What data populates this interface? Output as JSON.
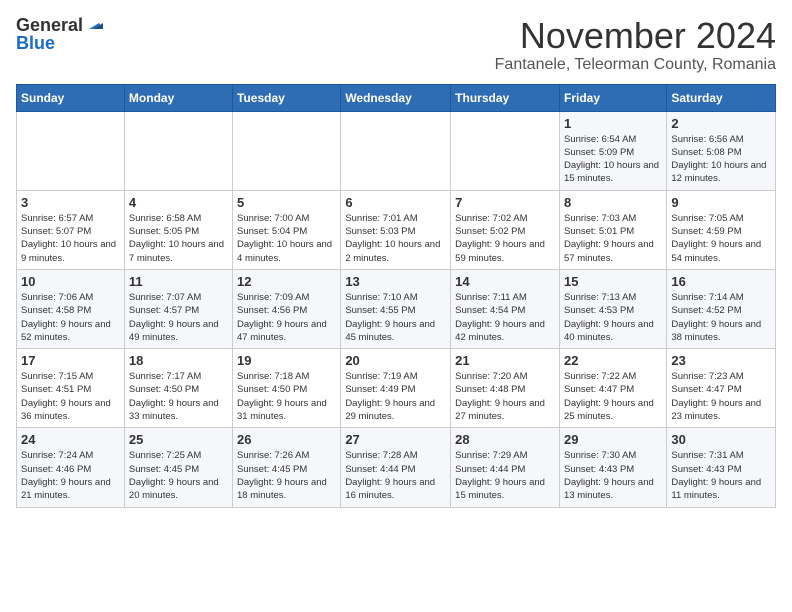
{
  "header": {
    "logo_general": "General",
    "logo_blue": "Blue",
    "month": "November 2024",
    "location": "Fantanele, Teleorman County, Romania"
  },
  "days_of_week": [
    "Sunday",
    "Monday",
    "Tuesday",
    "Wednesday",
    "Thursday",
    "Friday",
    "Saturday"
  ],
  "weeks": [
    [
      {
        "day": "",
        "info": ""
      },
      {
        "day": "",
        "info": ""
      },
      {
        "day": "",
        "info": ""
      },
      {
        "day": "",
        "info": ""
      },
      {
        "day": "",
        "info": ""
      },
      {
        "day": "1",
        "info": "Sunrise: 6:54 AM\nSunset: 5:09 PM\nDaylight: 10 hours and 15 minutes."
      },
      {
        "day": "2",
        "info": "Sunrise: 6:56 AM\nSunset: 5:08 PM\nDaylight: 10 hours and 12 minutes."
      }
    ],
    [
      {
        "day": "3",
        "info": "Sunrise: 6:57 AM\nSunset: 5:07 PM\nDaylight: 10 hours and 9 minutes."
      },
      {
        "day": "4",
        "info": "Sunrise: 6:58 AM\nSunset: 5:05 PM\nDaylight: 10 hours and 7 minutes."
      },
      {
        "day": "5",
        "info": "Sunrise: 7:00 AM\nSunset: 5:04 PM\nDaylight: 10 hours and 4 minutes."
      },
      {
        "day": "6",
        "info": "Sunrise: 7:01 AM\nSunset: 5:03 PM\nDaylight: 10 hours and 2 minutes."
      },
      {
        "day": "7",
        "info": "Sunrise: 7:02 AM\nSunset: 5:02 PM\nDaylight: 9 hours and 59 minutes."
      },
      {
        "day": "8",
        "info": "Sunrise: 7:03 AM\nSunset: 5:01 PM\nDaylight: 9 hours and 57 minutes."
      },
      {
        "day": "9",
        "info": "Sunrise: 7:05 AM\nSunset: 4:59 PM\nDaylight: 9 hours and 54 minutes."
      }
    ],
    [
      {
        "day": "10",
        "info": "Sunrise: 7:06 AM\nSunset: 4:58 PM\nDaylight: 9 hours and 52 minutes."
      },
      {
        "day": "11",
        "info": "Sunrise: 7:07 AM\nSunset: 4:57 PM\nDaylight: 9 hours and 49 minutes."
      },
      {
        "day": "12",
        "info": "Sunrise: 7:09 AM\nSunset: 4:56 PM\nDaylight: 9 hours and 47 minutes."
      },
      {
        "day": "13",
        "info": "Sunrise: 7:10 AM\nSunset: 4:55 PM\nDaylight: 9 hours and 45 minutes."
      },
      {
        "day": "14",
        "info": "Sunrise: 7:11 AM\nSunset: 4:54 PM\nDaylight: 9 hours and 42 minutes."
      },
      {
        "day": "15",
        "info": "Sunrise: 7:13 AM\nSunset: 4:53 PM\nDaylight: 9 hours and 40 minutes."
      },
      {
        "day": "16",
        "info": "Sunrise: 7:14 AM\nSunset: 4:52 PM\nDaylight: 9 hours and 38 minutes."
      }
    ],
    [
      {
        "day": "17",
        "info": "Sunrise: 7:15 AM\nSunset: 4:51 PM\nDaylight: 9 hours and 36 minutes."
      },
      {
        "day": "18",
        "info": "Sunrise: 7:17 AM\nSunset: 4:50 PM\nDaylight: 9 hours and 33 minutes."
      },
      {
        "day": "19",
        "info": "Sunrise: 7:18 AM\nSunset: 4:50 PM\nDaylight: 9 hours and 31 minutes."
      },
      {
        "day": "20",
        "info": "Sunrise: 7:19 AM\nSunset: 4:49 PM\nDaylight: 9 hours and 29 minutes."
      },
      {
        "day": "21",
        "info": "Sunrise: 7:20 AM\nSunset: 4:48 PM\nDaylight: 9 hours and 27 minutes."
      },
      {
        "day": "22",
        "info": "Sunrise: 7:22 AM\nSunset: 4:47 PM\nDaylight: 9 hours and 25 minutes."
      },
      {
        "day": "23",
        "info": "Sunrise: 7:23 AM\nSunset: 4:47 PM\nDaylight: 9 hours and 23 minutes."
      }
    ],
    [
      {
        "day": "24",
        "info": "Sunrise: 7:24 AM\nSunset: 4:46 PM\nDaylight: 9 hours and 21 minutes."
      },
      {
        "day": "25",
        "info": "Sunrise: 7:25 AM\nSunset: 4:45 PM\nDaylight: 9 hours and 20 minutes."
      },
      {
        "day": "26",
        "info": "Sunrise: 7:26 AM\nSunset: 4:45 PM\nDaylight: 9 hours and 18 minutes."
      },
      {
        "day": "27",
        "info": "Sunrise: 7:28 AM\nSunset: 4:44 PM\nDaylight: 9 hours and 16 minutes."
      },
      {
        "day": "28",
        "info": "Sunrise: 7:29 AM\nSunset: 4:44 PM\nDaylight: 9 hours and 15 minutes."
      },
      {
        "day": "29",
        "info": "Sunrise: 7:30 AM\nSunset: 4:43 PM\nDaylight: 9 hours and 13 minutes."
      },
      {
        "day": "30",
        "info": "Sunrise: 7:31 AM\nSunset: 4:43 PM\nDaylight: 9 hours and 11 minutes."
      }
    ]
  ]
}
